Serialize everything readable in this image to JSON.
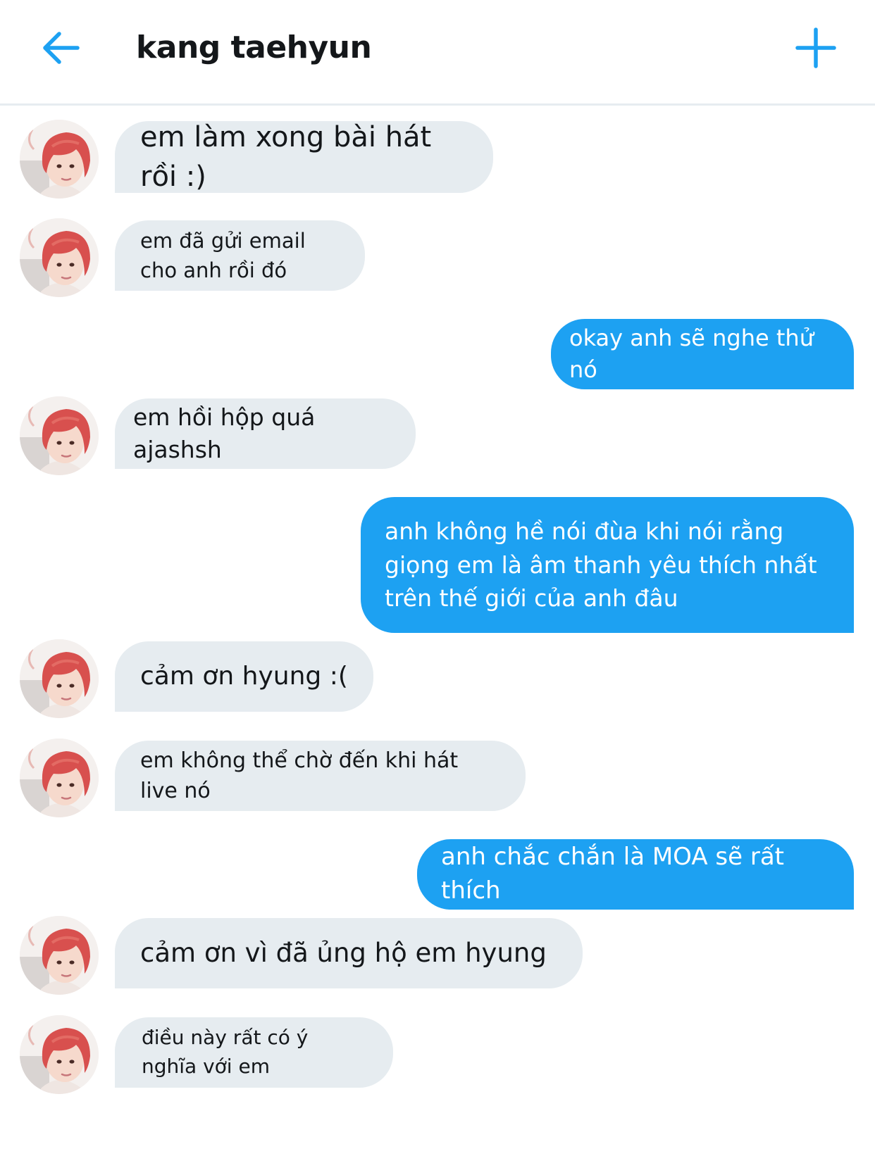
{
  "header": {
    "title": "kang taehyun"
  },
  "colors": {
    "accent": "#1da1f2",
    "incoming_bubble": "#e6ecf0",
    "text": "#14171a"
  },
  "icons": {
    "back": "arrow-left-icon",
    "new": "plus-icon"
  },
  "messages": [
    {
      "from": "them",
      "text": "em làm xong bài hát rồi :)"
    },
    {
      "from": "them",
      "text": "em đã gửi email cho anh rồi đó"
    },
    {
      "from": "me",
      "text": "okay anh sẽ nghe thử nó"
    },
    {
      "from": "them",
      "text": "em hồi hộp quá ajashsh"
    },
    {
      "from": "me",
      "text": "anh không hề nói đùa khi nói rằng giọng em là âm thanh yêu thích nhất trên  thế giới của anh đâu"
    },
    {
      "from": "them",
      "text": "cảm ơn hyung :("
    },
    {
      "from": "them",
      "text": "em không thể chờ đến khi hát live nó"
    },
    {
      "from": "me",
      "text": "anh chắc chắn là MOA sẽ rất thích"
    },
    {
      "from": "them",
      "text": "cảm ơn vì đã ủng hộ em hyung"
    },
    {
      "from": "them",
      "text": "điều này rất có ý nghĩa với em"
    }
  ]
}
